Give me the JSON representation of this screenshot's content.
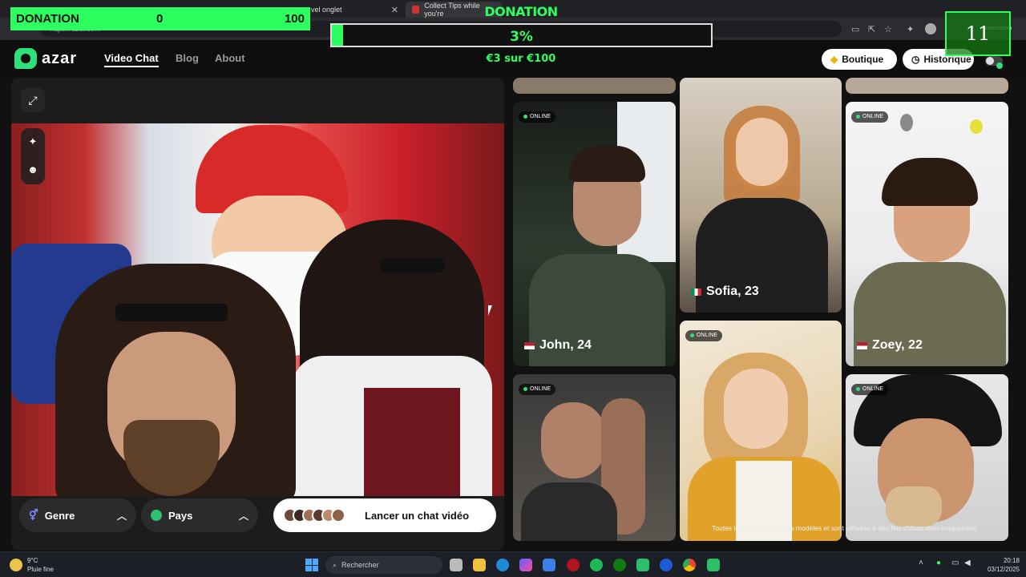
{
  "browser": {
    "tabs": [
      {
        "label": "vel onglet"
      },
      {
        "label": "Collect Tips while you're"
      }
    ],
    "address": "https://azar.com",
    "profile_label": "onversation"
  },
  "overlay": {
    "donation_label": "DONATION",
    "donation_current": "0",
    "donation_goal": "100",
    "goal_title": "DONATION",
    "progress_percent_label": "3%",
    "progress_fraction": 0.03,
    "progress_subtitle": "€3 sur €100",
    "counter": "11",
    "accent_color": "#2cff5f"
  },
  "header": {
    "logo_text": "azar",
    "nav": [
      {
        "label": "Video Chat",
        "active": true
      },
      {
        "label": "Blog",
        "active": false
      },
      {
        "label": "About",
        "active": false
      }
    ],
    "shop_label": "Boutique",
    "history_label": "Historique"
  },
  "video_panel": {
    "gender_label": "Genre",
    "country_label": "Pays",
    "launch_label": "Lancer un chat vidéo"
  },
  "profiles": [
    {
      "name": "John, 24",
      "status": "ONLINE"
    },
    {
      "name": "Sofia, 23",
      "status": ""
    },
    {
      "name": "Zoey, 22",
      "status": "ONLINE"
    },
    {
      "name": "",
      "status": "ONLINE"
    },
    {
      "name": "",
      "status": "ONLINE"
    },
    {
      "name": "",
      "status": "ONLINE"
    }
  ],
  "disclaimer": "Toutes les images sont des modèles et sont utilisées à des fins d'illustration uniquement.",
  "taskbar": {
    "temperature": "9°C",
    "weather": "Pluie fine",
    "search_placeholder": "Rechercher",
    "time": "20:18",
    "date": "03/12/2025"
  }
}
